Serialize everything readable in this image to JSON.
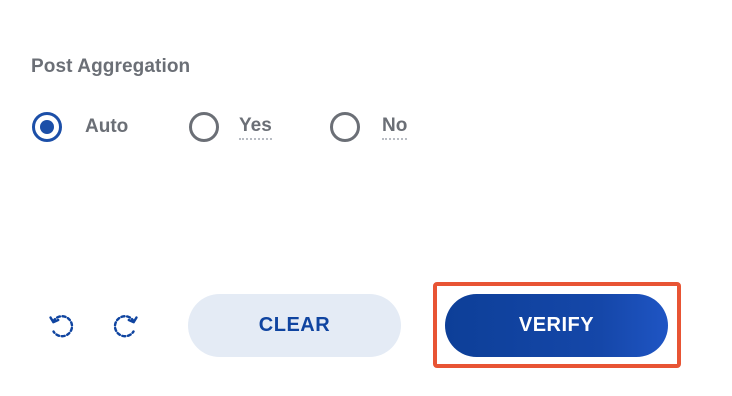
{
  "section": {
    "title": "Post Aggregation"
  },
  "options": [
    {
      "label": "Auto",
      "selected": true
    },
    {
      "label": "Yes",
      "selected": false
    },
    {
      "label": "No",
      "selected": false
    }
  ],
  "toolbar": {
    "undo_icon": "rotate-left-icon",
    "redo_icon": "rotate-right-icon",
    "clear_label": "CLEAR",
    "verify_label": "VERIFY"
  },
  "colors": {
    "accent": "#1c4fa8",
    "muted_text": "#6b6f76",
    "clear_bg": "#e4ebf5",
    "verify_bg": "#0f44a0",
    "highlight": "#e85434"
  }
}
